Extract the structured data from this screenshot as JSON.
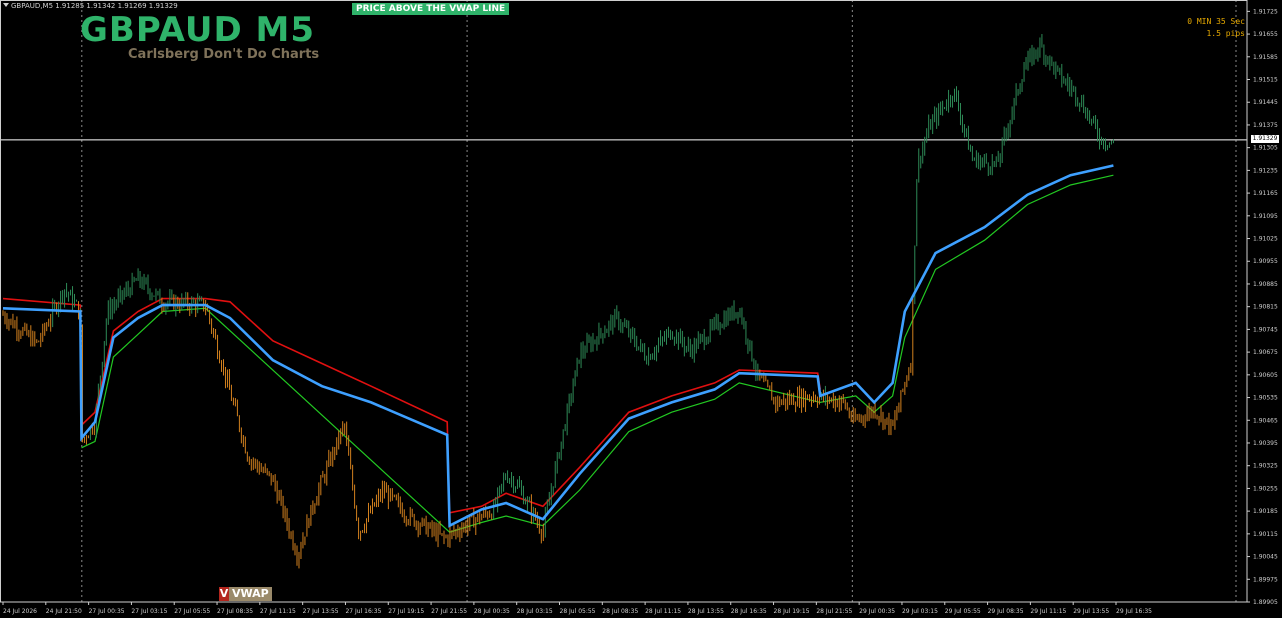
{
  "ohlc_header": "GBPAUD,M5  1.91285 1.91342 1.91269 1.91329",
  "title": "GBPAUD M5",
  "subtitle": "Carlsberg Don't Do Charts",
  "signal_banner": "PRICE ABOVE THE VWAP LINE",
  "timer": {
    "line1": "0 MIN 35 Sec",
    "line2": "1.5 pips"
  },
  "vwap_button": {
    "icon_letter": "V",
    "label": "VWAP"
  },
  "current_price": "1.91329",
  "colors": {
    "background": "#000000",
    "bull": "#2e8b57",
    "bear": "#d2801e",
    "vwap": "#3ea0ff",
    "upper_band": "#e01010",
    "lower_band": "#22c822",
    "banner": "#2fb36a",
    "timer": "#e5a800"
  },
  "chart_data": {
    "type": "candlestick",
    "y_ticks": [
      "1.91725",
      "1.91655",
      "1.91585",
      "1.91515",
      "1.91445",
      "1.91375",
      "1.91305",
      "1.91235",
      "1.91165",
      "1.91095",
      "1.91025",
      "1.90955",
      "1.90885",
      "1.90815",
      "1.90745",
      "1.90675",
      "1.90605",
      "1.90535",
      "1.90465",
      "1.90395",
      "1.90325",
      "1.90255",
      "1.90185",
      "1.90115",
      "1.90045",
      "1.89975",
      "1.89905"
    ],
    "y_range": [
      1.89905,
      1.9176
    ],
    "x_ticks": [
      "24 Jul 2026",
      "24 Jul 21:50",
      "27 Jul 00:35",
      "27 Jul 03:15",
      "27 Jul 05:55",
      "27 Jul 08:35",
      "27 Jul 11:15",
      "27 Jul 13:55",
      "27 Jul 16:35",
      "27 Jul 19:15",
      "27 Jul 21:55",
      "28 Jul 00:35",
      "28 Jul 03:15",
      "28 Jul 05:55",
      "28 Jul 08:35",
      "28 Jul 11:15",
      "28 Jul 13:55",
      "28 Jul 16:35",
      "28 Jul 19:15",
      "28 Jul 21:55",
      "29 Jul 00:35",
      "29 Jul 03:15",
      "29 Jul 05:55",
      "29 Jul 08:35",
      "29 Jul 11:15",
      "29 Jul 13:55",
      "29 Jul 16:35"
    ],
    "session_breaks": [
      "24 Jul 21:50",
      "27 Jul 21:55",
      "28 Jul 21:55"
    ],
    "price_path": [
      {
        "t": 0.0,
        "p": 1.9079
      },
      {
        "t": 0.028,
        "p": 1.907
      },
      {
        "t": 0.05,
        "p": 1.9087
      },
      {
        "t": 0.063,
        "p": 1.908
      },
      {
        "t": 0.064,
        "p": 1.904
      },
      {
        "t": 0.075,
        "p": 1.9046
      },
      {
        "t": 0.085,
        "p": 1.908
      },
      {
        "t": 0.11,
        "p": 1.909
      },
      {
        "t": 0.13,
        "p": 1.9083
      },
      {
        "t": 0.165,
        "p": 1.9082
      },
      {
        "t": 0.185,
        "p": 1.9055
      },
      {
        "t": 0.2,
        "p": 1.9035
      },
      {
        "t": 0.22,
        "p": 1.9028
      },
      {
        "t": 0.24,
        "p": 1.9005
      },
      {
        "t": 0.255,
        "p": 1.9023
      },
      {
        "t": 0.278,
        "p": 1.9045
      },
      {
        "t": 0.29,
        "p": 1.9012
      },
      {
        "t": 0.31,
        "p": 1.9025
      },
      {
        "t": 0.33,
        "p": 1.9017
      },
      {
        "t": 0.36,
        "p": 1.901
      },
      {
        "t": 0.372,
        "p": 1.9013
      },
      {
        "t": 0.385,
        "p": 1.9016
      },
      {
        "t": 0.4,
        "p": 1.9019
      },
      {
        "t": 0.41,
        "p": 1.903
      },
      {
        "t": 0.42,
        "p": 1.9026
      },
      {
        "t": 0.44,
        "p": 1.9012
      },
      {
        "t": 0.45,
        "p": 1.9031
      },
      {
        "t": 0.47,
        "p": 1.9067
      },
      {
        "t": 0.5,
        "p": 1.9078
      },
      {
        "t": 0.525,
        "p": 1.9066
      },
      {
        "t": 0.545,
        "p": 1.9074
      },
      {
        "t": 0.56,
        "p": 1.9068
      },
      {
        "t": 0.585,
        "p": 1.9077
      },
      {
        "t": 0.6,
        "p": 1.9081
      },
      {
        "t": 0.615,
        "p": 1.906
      },
      {
        "t": 0.63,
        "p": 1.9052
      },
      {
        "t": 0.66,
        "p": 1.9054
      },
      {
        "t": 0.685,
        "p": 1.9052
      },
      {
        "t": 0.693,
        "p": 1.9046
      },
      {
        "t": 0.71,
        "p": 1.905
      },
      {
        "t": 0.725,
        "p": 1.9044
      },
      {
        "t": 0.74,
        "p": 1.9065
      },
      {
        "t": 0.745,
        "p": 1.9125
      },
      {
        "t": 0.755,
        "p": 1.9137
      },
      {
        "t": 0.775,
        "p": 1.9148
      },
      {
        "t": 0.79,
        "p": 1.9127
      },
      {
        "t": 0.81,
        "p": 1.9125
      },
      {
        "t": 0.832,
        "p": 1.9155
      },
      {
        "t": 0.845,
        "p": 1.9162
      },
      {
        "t": 0.86,
        "p": 1.9153
      },
      {
        "t": 0.875,
        "p": 1.9147
      },
      {
        "t": 0.895,
        "p": 1.9133
      },
      {
        "t": 0.905,
        "p": 1.9132
      }
    ],
    "vwap": [
      {
        "t": 0.0,
        "p": 1.9081
      },
      {
        "t": 0.063,
        "p": 1.908
      },
      {
        "t": 0.064,
        "p": 1.9041
      },
      {
        "t": 0.075,
        "p": 1.9046
      },
      {
        "t": 0.09,
        "p": 1.9072
      },
      {
        "t": 0.11,
        "p": 1.9078
      },
      {
        "t": 0.13,
        "p": 1.9082
      },
      {
        "t": 0.165,
        "p": 1.9082
      },
      {
        "t": 0.185,
        "p": 1.9078
      },
      {
        "t": 0.22,
        "p": 1.9065
      },
      {
        "t": 0.26,
        "p": 1.9057
      },
      {
        "t": 0.3,
        "p": 1.9052
      },
      {
        "t": 0.362,
        "p": 1.9042
      },
      {
        "t": 0.364,
        "p": 1.9014
      },
      {
        "t": 0.39,
        "p": 1.9019
      },
      {
        "t": 0.41,
        "p": 1.9021
      },
      {
        "t": 0.44,
        "p": 1.9016
      },
      {
        "t": 0.47,
        "p": 1.903
      },
      {
        "t": 0.51,
        "p": 1.9047
      },
      {
        "t": 0.545,
        "p": 1.9052
      },
      {
        "t": 0.58,
        "p": 1.9056
      },
      {
        "t": 0.6,
        "p": 1.9061
      },
      {
        "t": 0.664,
        "p": 1.906
      },
      {
        "t": 0.666,
        "p": 1.9054
      },
      {
        "t": 0.695,
        "p": 1.9058
      },
      {
        "t": 0.71,
        "p": 1.9052
      },
      {
        "t": 0.725,
        "p": 1.9058
      },
      {
        "t": 0.735,
        "p": 1.908
      },
      {
        "t": 0.76,
        "p": 1.9098
      },
      {
        "t": 0.8,
        "p": 1.9106
      },
      {
        "t": 0.835,
        "p": 1.9116
      },
      {
        "t": 0.87,
        "p": 1.9122
      },
      {
        "t": 0.905,
        "p": 1.9125
      }
    ],
    "upper_band": [
      {
        "t": 0.0,
        "p": 1.9084
      },
      {
        "t": 0.063,
        "p": 1.9082
      },
      {
        "t": 0.064,
        "p": 1.9045
      },
      {
        "t": 0.075,
        "p": 1.9049
      },
      {
        "t": 0.09,
        "p": 1.9074
      },
      {
        "t": 0.11,
        "p": 1.908
      },
      {
        "t": 0.13,
        "p": 1.9084
      },
      {
        "t": 0.165,
        "p": 1.9084
      },
      {
        "t": 0.185,
        "p": 1.9083
      },
      {
        "t": 0.22,
        "p": 1.9071
      },
      {
        "t": 0.26,
        "p": 1.9064
      },
      {
        "t": 0.3,
        "p": 1.9057
      },
      {
        "t": 0.362,
        "p": 1.9046
      },
      {
        "t": 0.364,
        "p": 1.9018
      },
      {
        "t": 0.39,
        "p": 1.902
      },
      {
        "t": 0.41,
        "p": 1.9024
      },
      {
        "t": 0.44,
        "p": 1.902
      },
      {
        "t": 0.47,
        "p": 1.9032
      },
      {
        "t": 0.51,
        "p": 1.9049
      },
      {
        "t": 0.545,
        "p": 1.9054
      },
      {
        "t": 0.58,
        "p": 1.9058
      },
      {
        "t": 0.6,
        "p": 1.9062
      },
      {
        "t": 0.664,
        "p": 1.9061
      },
      {
        "t": 0.666,
        "p": 1.9056
      }
    ],
    "lower_band": [
      {
        "t": 0.064,
        "p": 1.9038
      },
      {
        "t": 0.075,
        "p": 1.904
      },
      {
        "t": 0.09,
        "p": 1.9066
      },
      {
        "t": 0.11,
        "p": 1.9073
      },
      {
        "t": 0.13,
        "p": 1.908
      },
      {
        "t": 0.165,
        "p": 1.9081
      },
      {
        "t": 0.364,
        "p": 1.9012
      },
      {
        "t": 0.39,
        "p": 1.9015
      },
      {
        "t": 0.41,
        "p": 1.9017
      },
      {
        "t": 0.44,
        "p": 1.9014
      },
      {
        "t": 0.47,
        "p": 1.9025
      },
      {
        "t": 0.51,
        "p": 1.9043
      },
      {
        "t": 0.545,
        "p": 1.9049
      },
      {
        "t": 0.58,
        "p": 1.9053
      },
      {
        "t": 0.6,
        "p": 1.9058
      },
      {
        "t": 0.666,
        "p": 1.9052
      },
      {
        "t": 0.695,
        "p": 1.9054
      },
      {
        "t": 0.71,
        "p": 1.9049
      },
      {
        "t": 0.725,
        "p": 1.9054
      },
      {
        "t": 0.735,
        "p": 1.9072
      },
      {
        "t": 0.76,
        "p": 1.9093
      },
      {
        "t": 0.8,
        "p": 1.9102
      },
      {
        "t": 0.835,
        "p": 1.9113
      },
      {
        "t": 0.87,
        "p": 1.9119
      },
      {
        "t": 0.905,
        "p": 1.9122
      }
    ]
  }
}
